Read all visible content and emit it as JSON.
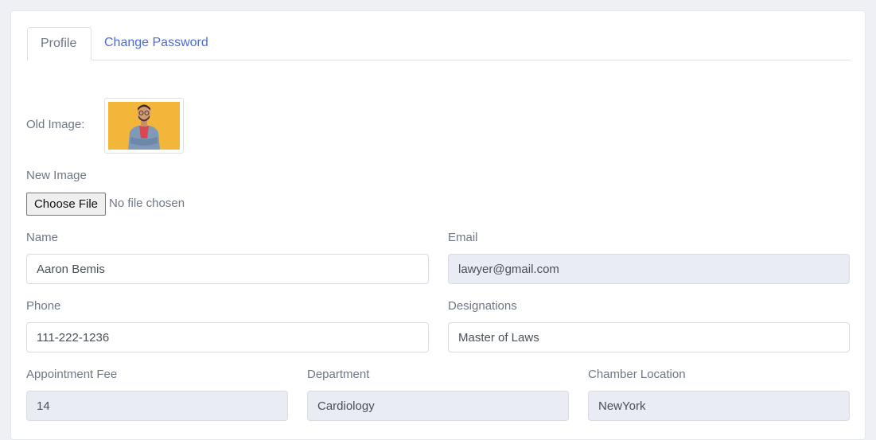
{
  "tabs": {
    "profile": "Profile",
    "change_password": "Change Password"
  },
  "form": {
    "old_image_label": "Old Image:",
    "new_image_label": "New Image",
    "choose_file_label": "Choose File",
    "file_status": "No file chosen",
    "name_label": "Name",
    "name_value": "Aaron Bemis",
    "email_label": "Email",
    "email_value": "lawyer@gmail.com",
    "phone_label": "Phone",
    "phone_value": "111-222-1236",
    "designations_label": "Designations",
    "designations_value": "Master of Laws",
    "fee_label": "Appointment Fee",
    "fee_value": "14",
    "department_label": "Department",
    "department_value": "Cardiology",
    "chamber_label": "Chamber Location",
    "chamber_value": "NewYork"
  },
  "colors": {
    "link": "#4c6bd6",
    "readonly_bg": "#e9ecf2",
    "thumb_bg": "#f2b63a"
  }
}
